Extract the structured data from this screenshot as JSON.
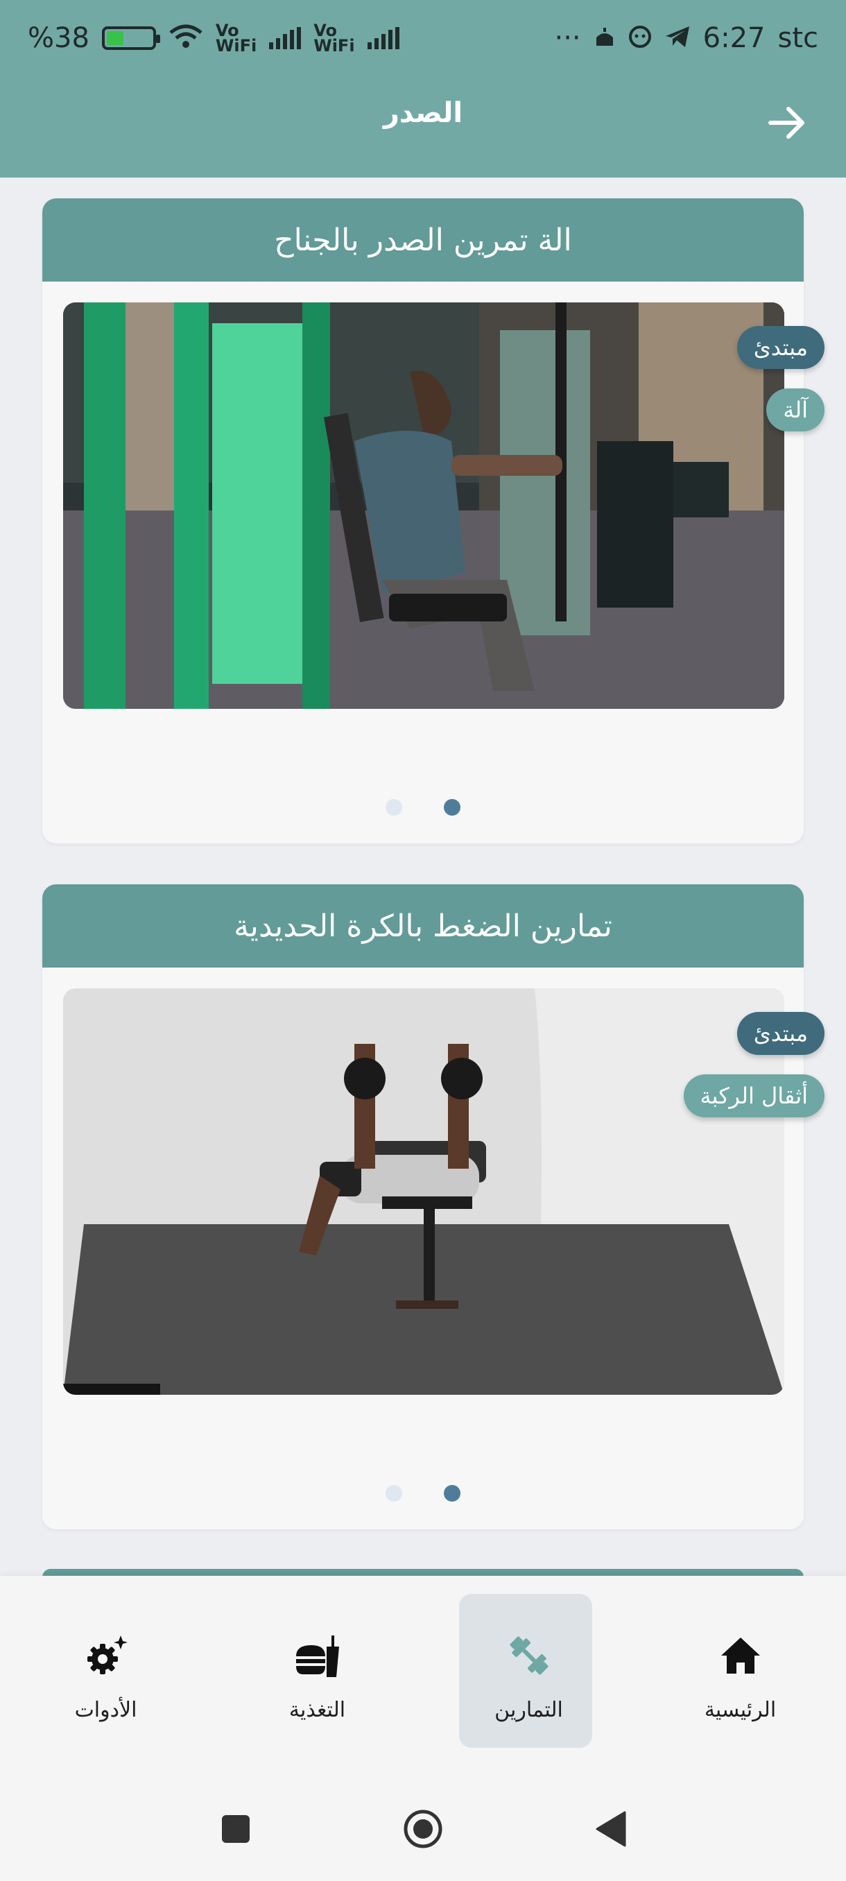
{
  "status_bar": {
    "battery": "%38",
    "wifi_label_1": "Vo\nWiFi",
    "wifi_label_2": "Vo\nWiFi",
    "more": "···",
    "time": "6:27",
    "carrier": "stc",
    "battery_level": 0.38
  },
  "app_bar": {
    "title": "الصدر"
  },
  "exercises": [
    {
      "title": "الة تمرين الصدر بالجناح",
      "level": "مبتدئ",
      "equipment": "آلة",
      "slide_count": 2,
      "active_slide": 0
    },
    {
      "title": "تمارين الضغط بالكرة الحديدية",
      "level": "مبتدئ",
      "equipment": "أثقال الركبة",
      "slide_count": 2,
      "active_slide": 0
    }
  ],
  "bottom_nav": {
    "items": [
      {
        "label": "الرئيسية",
        "icon": "home-icon"
      },
      {
        "label": "التمارين",
        "icon": "dumbbell-icon",
        "selected": true
      },
      {
        "label": "التغذية",
        "icon": "food-icon"
      },
      {
        "label": "الأدوات",
        "icon": "tools-gear-icon"
      }
    ]
  },
  "colors": {
    "primary": "#629b97",
    "header": "#73a9a5",
    "level_chip": "#3f6b7c",
    "equipment_chip": "#6ea7a3",
    "active_dot": "#4f7d99"
  }
}
